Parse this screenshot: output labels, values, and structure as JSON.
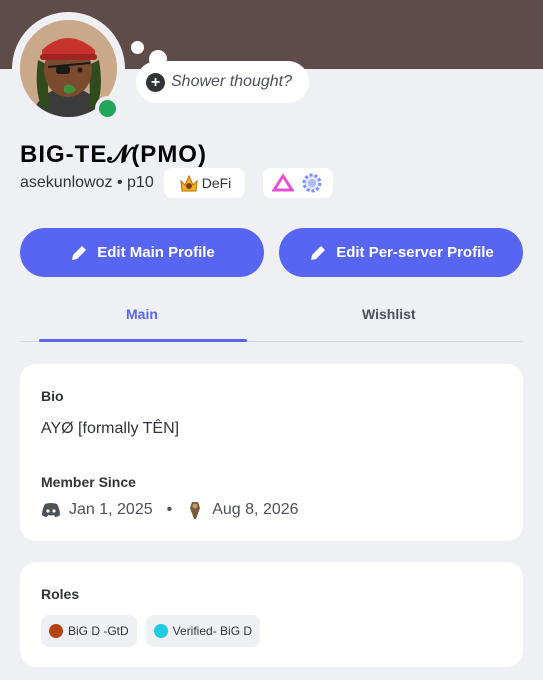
{
  "profile": {
    "display_name": "BIG-TE𝓝(PMO)",
    "username": "asekunlowoz",
    "pronouns_sep": "•",
    "pronouns": "p10",
    "guild_tag": "DeFi",
    "status": "online",
    "custom_status": "Shower thought?"
  },
  "buttons": {
    "edit_main": "Edit Main Profile",
    "edit_server": "Edit Per-server Profile"
  },
  "tabs": [
    {
      "label": "Main",
      "selected": true
    },
    {
      "label": "Wishlist",
      "selected": false
    }
  ],
  "bio": {
    "heading": "Bio",
    "text": "AYØ [formally TÊN]"
  },
  "member_since": {
    "heading": "Member Since",
    "discord_date": "Jan 1, 2025",
    "separator": "•",
    "server_date": "Aug 8, 2026"
  },
  "roles": {
    "heading": "Roles",
    "items": [
      {
        "name": "BiG D -GtD",
        "color": "#b3430f"
      },
      {
        "name": "Verified- BiG D",
        "color": "#1ecbe1"
      }
    ]
  },
  "colors": {
    "accent": "#5865f2",
    "banner": "#5e4c4b",
    "online": "#23a55a"
  }
}
